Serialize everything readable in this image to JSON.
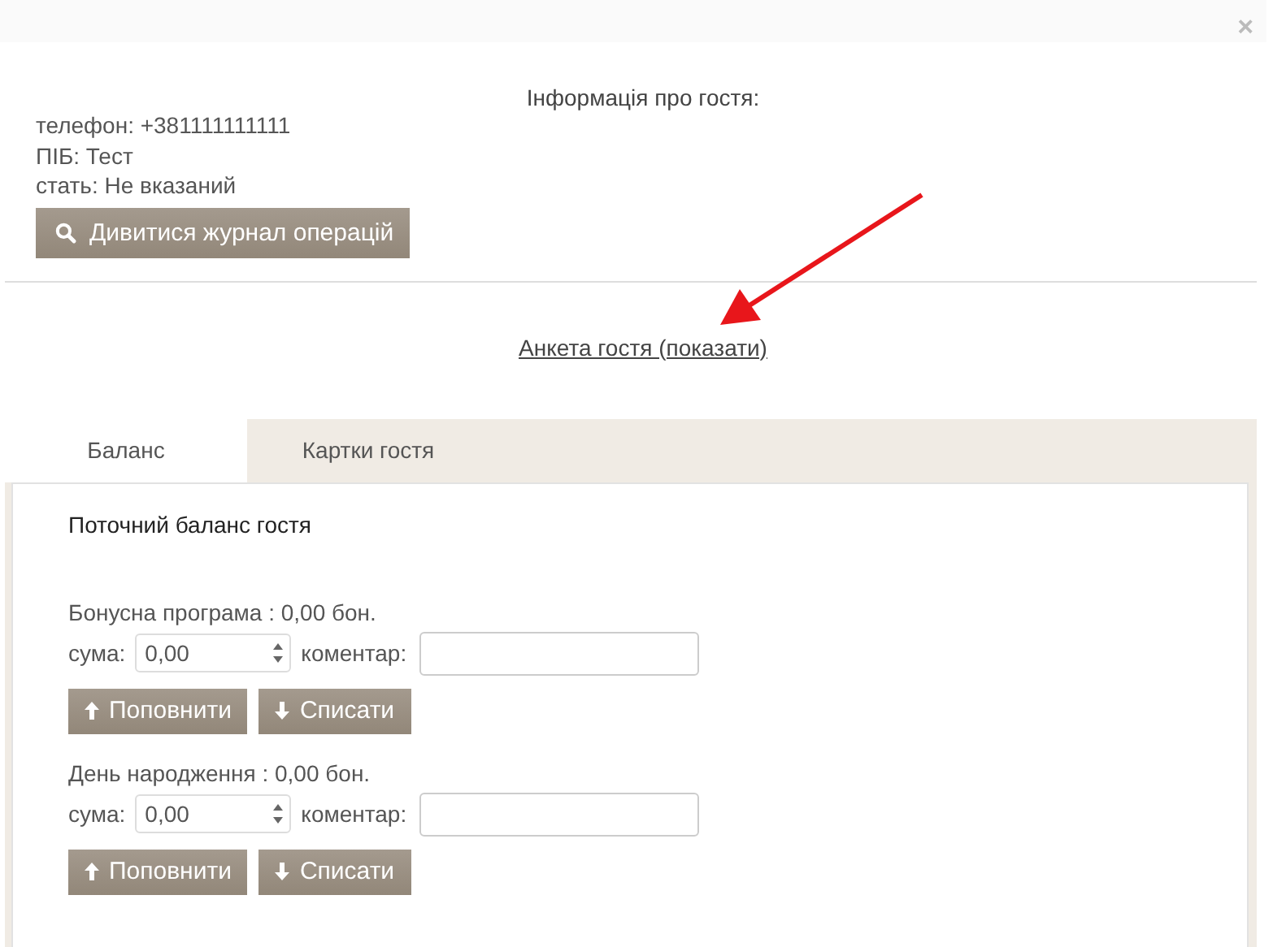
{
  "dialog": {
    "close": "×",
    "title": "Інформація про гостя:"
  },
  "guest": [
    "телефон: +381111111111",
    "ПІБ: Тест",
    "стать: Не вказаний"
  ],
  "log_button": "Дивитися журнал операцій",
  "profile_link": "Анкета гостя (показати)",
  "tabs": [
    {
      "label": "Баланс",
      "selected": true
    },
    {
      "label": "Картки гостя",
      "selected": false
    }
  ],
  "panel": {
    "heading": "Поточний баланс гостя",
    "accounts": [
      {
        "title": "Бонусна програма : 0,00 бон.",
        "amount_label": "сума:",
        "amount": "0,00",
        "comment_label": "коментар:",
        "buttons": [
          "Поповнити",
          "Списати"
        ]
      },
      {
        "title": "День народження : 0,00 бон.",
        "amount_label": "сума:",
        "amount": "0,00",
        "comment_label": "коментар:",
        "buttons": [
          "Поповнити",
          "Списати"
        ]
      }
    ]
  }
}
